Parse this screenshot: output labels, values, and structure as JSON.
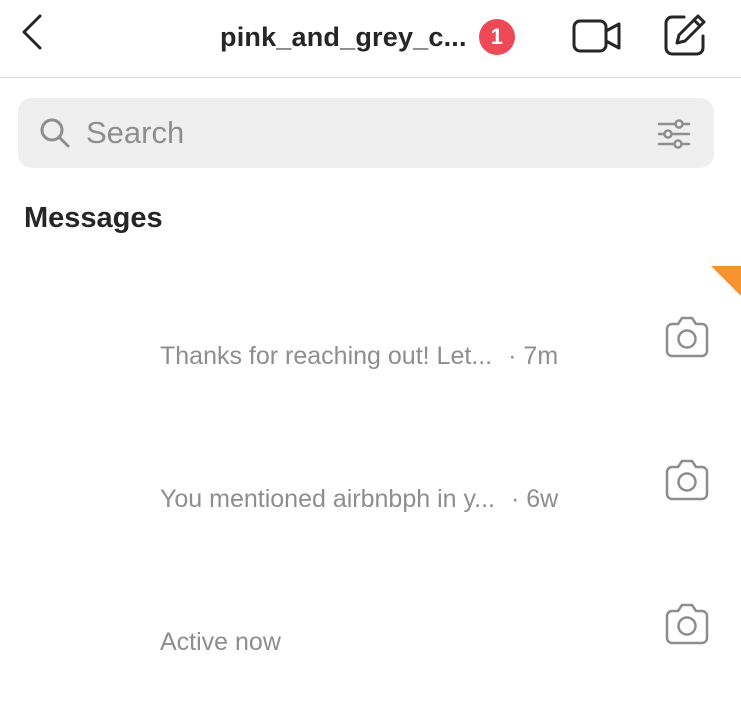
{
  "header": {
    "back_icon": "chevron-left-icon",
    "title": "pink_and_grey_c...",
    "badge_count": "1",
    "badge_color": "#ed4956",
    "video_icon": "video-camera-icon",
    "compose_icon": "compose-icon"
  },
  "search": {
    "placeholder": "Search",
    "value": "",
    "icon": "search-icon",
    "filter_icon": "filter-sliders-icon"
  },
  "section": {
    "title": "Messages"
  },
  "accent": {
    "corner_flag_color": "#f5932f"
  },
  "threads": [
    {
      "preview": "Thanks for reaching out! Let...",
      "separator": "·",
      "time": "7m",
      "action_icon": "camera-icon"
    },
    {
      "preview": "You mentioned airbnbph in y...",
      "separator": "·",
      "time": "6w",
      "action_icon": "camera-icon"
    },
    {
      "preview": "Active now",
      "separator": "",
      "time": "",
      "action_icon": "camera-icon"
    }
  ]
}
